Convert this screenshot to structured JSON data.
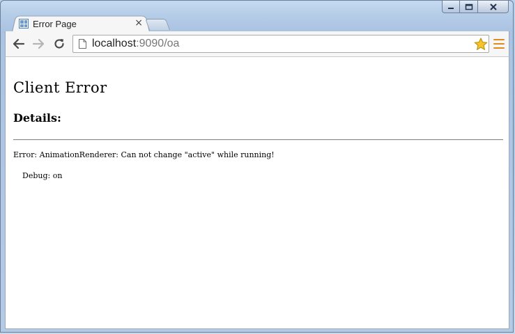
{
  "window": {
    "caption_buttons": [
      "minimize-icon",
      "maximize-icon",
      "close-icon"
    ]
  },
  "tab": {
    "title": "Error Page",
    "close_glyph": "×",
    "favicon": "page-grid-icon"
  },
  "toolbar": {
    "url_host": "localhost",
    "url_path": ":9090/oa",
    "accent": "#e08a1e",
    "star_color": "#f2b600"
  },
  "page": {
    "title": "Client Error",
    "details_heading": "Details:",
    "error_message": "Error: AnimationRenderer: Can not change \"active\" while running!",
    "debug": "Debug: on"
  }
}
